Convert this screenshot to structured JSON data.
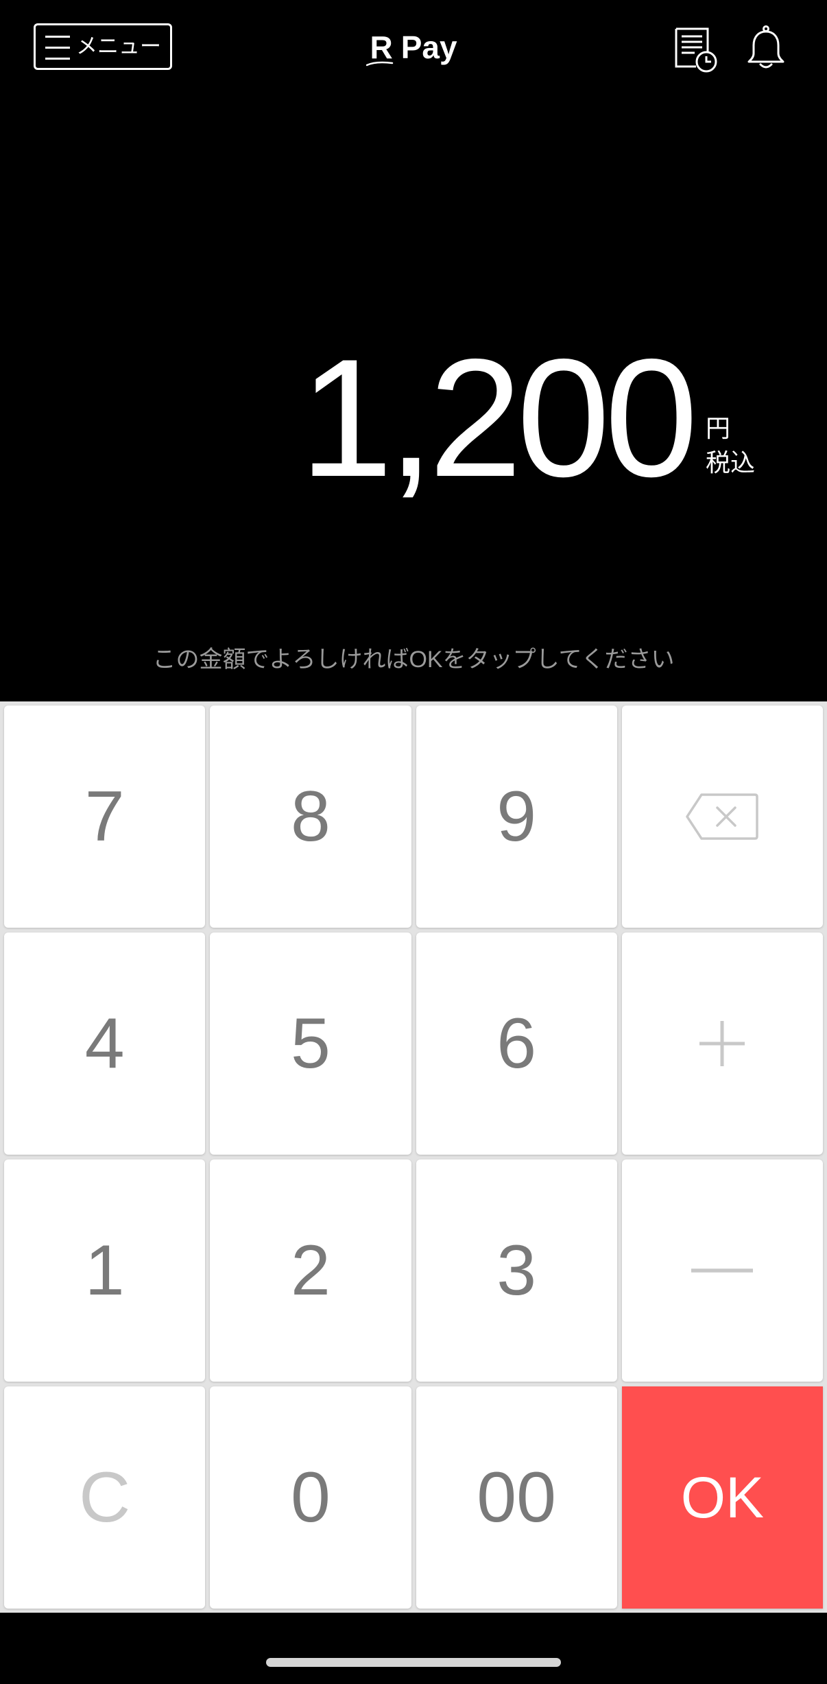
{
  "header": {
    "menu_label": "メニュー",
    "menu_icon": "hamburger-icon",
    "logo": {
      "mark": "R",
      "text": "Pay"
    },
    "right_icons": [
      "history-icon",
      "bell-icon"
    ]
  },
  "amount": {
    "value": "1,200",
    "unit": "円",
    "tax_note": "税込"
  },
  "instruction": "この金額でよろしければOKをタップしてください",
  "keypad": {
    "keys": [
      {
        "label": "7"
      },
      {
        "label": "8"
      },
      {
        "label": "9"
      },
      {
        "icon": "backspace-icon"
      },
      {
        "label": "4"
      },
      {
        "label": "5"
      },
      {
        "label": "6"
      },
      {
        "icon": "plus-icon"
      },
      {
        "label": "1"
      },
      {
        "label": "2"
      },
      {
        "label": "3"
      },
      {
        "icon": "minus-icon"
      },
      {
        "label": "C"
      },
      {
        "label": "0"
      },
      {
        "label": "00"
      },
      {
        "label": "OK"
      }
    ]
  },
  "colors": {
    "background": "#000000",
    "keypad_bg": "#e3e3e3",
    "key_bg": "#ffffff",
    "digit": "#7a7a7a",
    "muted": "#c8c8c8",
    "ok_key": "#ff4f4f",
    "ok_text": "#ffffff",
    "instruction": "#9a9a9a"
  }
}
